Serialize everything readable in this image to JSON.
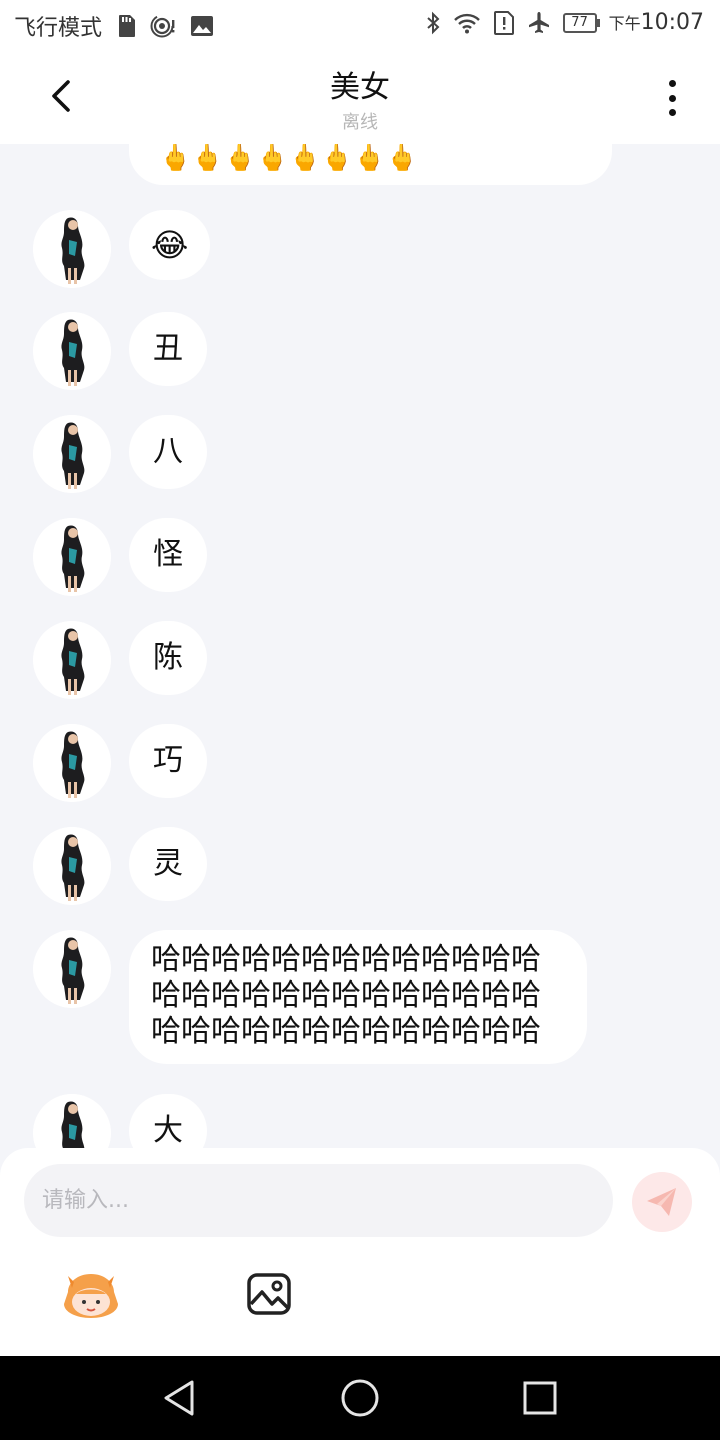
{
  "status_bar": {
    "carrier": "飞行模式",
    "battery": "77",
    "time_prefix": "下午",
    "time": "10:07",
    "icons": [
      "sd-card-icon",
      "hotspot-icon",
      "image-icon",
      "bluetooth-icon",
      "wifi-icon",
      "alert-icon",
      "airplane-icon",
      "battery-icon"
    ]
  },
  "header": {
    "title": "美女",
    "subtitle": "离线",
    "back_icon": "chevron-left-icon",
    "more_icon": "more-vertical-icon"
  },
  "chat": {
    "partial_message": "🖕🖕🖕🖕🖕🖕🖕🖕",
    "messages": [
      {
        "text": "😂",
        "kind": "emoji"
      },
      {
        "text": "丑"
      },
      {
        "text": "八"
      },
      {
        "text": "怪"
      },
      {
        "text": "陈"
      },
      {
        "text": "巧"
      },
      {
        "text": "灵"
      },
      {
        "text": "哈哈哈哈哈哈哈哈哈哈哈哈哈哈哈哈哈哈哈哈哈哈哈哈哈哈哈哈哈哈哈哈哈哈哈哈哈哈哈",
        "kind": "long"
      },
      {
        "text": "大"
      }
    ]
  },
  "composer": {
    "placeholder": "请输入...",
    "send_icon": "paper-plane-icon",
    "emoji_icon": "cartoon-emoji-icon",
    "image_icon": "image-icon"
  },
  "nav_bar": {
    "icons": [
      "back-triangle-icon",
      "home-circle-icon",
      "recents-square-icon"
    ]
  },
  "colors": {
    "background": "#f4f5f9",
    "bubble": "#ffffff",
    "send_button": "#fde8e8",
    "send_icon": "#f6b8b0"
  }
}
